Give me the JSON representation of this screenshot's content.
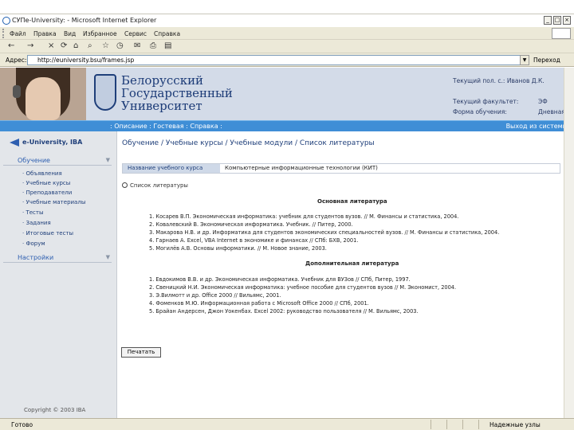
{
  "window": {
    "title": "СУПе-University: - Microsoft Internet Explorer",
    "buttons": {
      "minimize": "_",
      "maximize": "□",
      "close": "×"
    }
  },
  "menu": [
    "Файл",
    "Правка",
    "Вид",
    "Избранное",
    "Сервис",
    "Справка"
  ],
  "toolbar": {
    "back": "←",
    "forward": "→",
    "stop": "×",
    "refresh": "⟳",
    "home": "⌂",
    "search": "⌕",
    "favorites": "☆",
    "history": "◷",
    "mail": "✉",
    "print": "⎙",
    "edit": "▤"
  },
  "address": {
    "label": "Адрес:",
    "value": "http://euniversity.bsu/frames.jsp",
    "go_label": "Переход"
  },
  "header": {
    "university_lines": [
      "Белорусский",
      "Государственный",
      "Университет"
    ],
    "current_user_label": "Текущий пол. с.: Иванов Д.К.",
    "faculty_label": "Текущий факультет:",
    "faculty_value": "ЭФ",
    "study_form_label": "Форма обучения:",
    "study_form_value": "Дневная"
  },
  "nav": {
    "links": ": Описание : Гостевая : Справка :",
    "logout": "Выход из системы"
  },
  "sidebar": {
    "logo": "e-University, IBA",
    "section1": "Обучение",
    "items": [
      "· Объявления",
      "· Учебные курсы",
      "· Преподаватели",
      "· Учебные материалы",
      "· Тесты",
      "· Задания",
      "· Итоговые тесты",
      "· Форум"
    ],
    "section2": "Настройки",
    "copyright": "Copyright © 2003 IBA"
  },
  "main": {
    "breadcrumb": "Обучение / Учебные курсы / Учебные модули / Список литературы",
    "course_header": "Название учебного курса",
    "course_value": "Компьютерные информационные технологии (КИТ)",
    "sub_title": "Список литературы",
    "basic_title": "Основная литература",
    "basic": [
      "1. Косарев В.П. Экономическая информатика: учебник для студентов вузов. // М. Финансы и статистика, 2004.",
      "2. Ковалевский В. Экономическая информатика. Учебник. // Питер, 2000.",
      "3. Макарова Н.В. и др. Информатика для студентов экономических специальностей вузов. // М. Финансы и статистика, 2004.",
      "4. Гарнаев А. Excel, VBA Internet в экономике и финансах // СПб: БХВ, 2001.",
      "5. Могилёв А.В. Основы информатики. // М. Новое знание, 2003."
    ],
    "extra_title": "Дополнительная литература",
    "extra": [
      "1. Евдокимов В.В. и др. Экономическая информатика. Учебник для ВУЗов // СПб, Питер, 1997.",
      "2. Свеницкий Н.И. Экономическая информатика: учебное пособие для студентов вузов // М. Экономист, 2004.",
      "3. Э.Вилмотт и др. Office 2000 // Вильямс, 2001.",
      "4. Фоменков М.Ю. Информационная работа с Microsoft Office 2000 // СПб, 2001.",
      "5. Брайан Андерсен, Джон Уокенбах. Excel 2002: руководство пользователя // М. Вильямс, 2003."
    ],
    "print_button": "Печатать"
  },
  "status": {
    "left": "Готово",
    "zone": "Надежные узлы"
  }
}
